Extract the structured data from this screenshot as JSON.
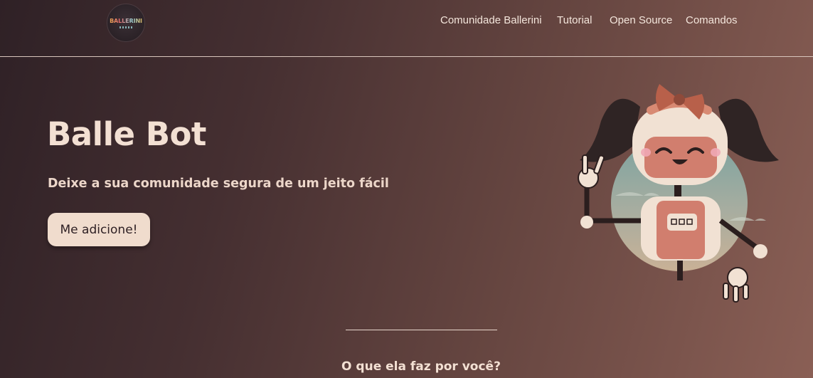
{
  "header": {
    "logo_text": "BALLERINI",
    "nav": [
      {
        "label": "Comunidade Ballerini"
      },
      {
        "label": "Tutorial"
      },
      {
        "label": "Open Source"
      },
      {
        "label": "Comandos"
      }
    ]
  },
  "hero": {
    "title": "Balle Bot",
    "subtitle": "Deixe a sua comunidade segura de um jeito fácil",
    "cta_label": "Me adicione!"
  },
  "section": {
    "title": "O que ela faz por você?"
  },
  "icons": {
    "mascot": "robot-girl-mascot-illustration"
  },
  "colors": {
    "button_bg": "#f0dccd",
    "text": "#f3e0d3",
    "accent_bow": "#b8604a"
  }
}
